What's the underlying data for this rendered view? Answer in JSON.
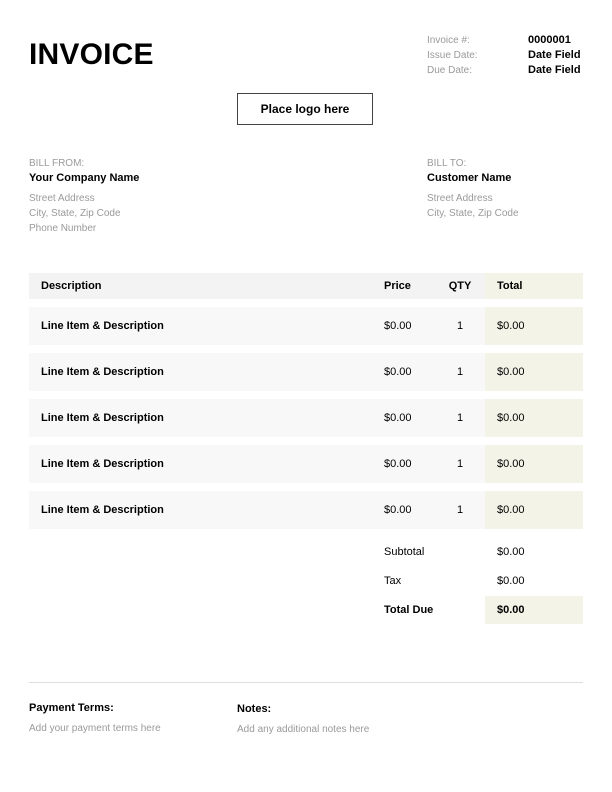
{
  "title": "INVOICE",
  "meta": {
    "invoice_label": "Invoice #:",
    "invoice_value": "0000001",
    "issue_label": "Issue Date:",
    "issue_value": "Date Field",
    "due_label": "Due Date:",
    "due_value": "Date Field"
  },
  "logo_placeholder": "Place logo here",
  "bill_from": {
    "label": "BILL FROM:",
    "name": "Your Company Name",
    "address": "Street Address",
    "city": "City, State, Zip Code",
    "phone": "Phone Number"
  },
  "bill_to": {
    "label": "BILL TO:",
    "name": "Customer Name",
    "address": "Street Address",
    "city": "City, State, Zip Code"
  },
  "table": {
    "headers": {
      "description": "Description",
      "price": "Price",
      "qty": "QTY",
      "total": "Total"
    },
    "rows": [
      {
        "description": "Line Item & Description",
        "price": "$0.00",
        "qty": "1",
        "total": "$0.00"
      },
      {
        "description": "Line Item & Description",
        "price": "$0.00",
        "qty": "1",
        "total": "$0.00"
      },
      {
        "description": "Line Item & Description",
        "price": "$0.00",
        "qty": "1",
        "total": "$0.00"
      },
      {
        "description": "Line Item & Description",
        "price": "$0.00",
        "qty": "1",
        "total": "$0.00"
      },
      {
        "description": "Line Item & Description",
        "price": "$0.00",
        "qty": "1",
        "total": "$0.00"
      }
    ]
  },
  "summary": {
    "subtotal_label": "Subtotal",
    "subtotal_value": "$0.00",
    "tax_label": "Tax",
    "tax_value": "$0.00",
    "total_label": "Total Due",
    "total_value": "$0.00"
  },
  "footer": {
    "terms_label": "Payment Terms:",
    "terms_text": "Add your payment terms here",
    "notes_label": "Notes:",
    "notes_text": "Add any additional notes here"
  }
}
